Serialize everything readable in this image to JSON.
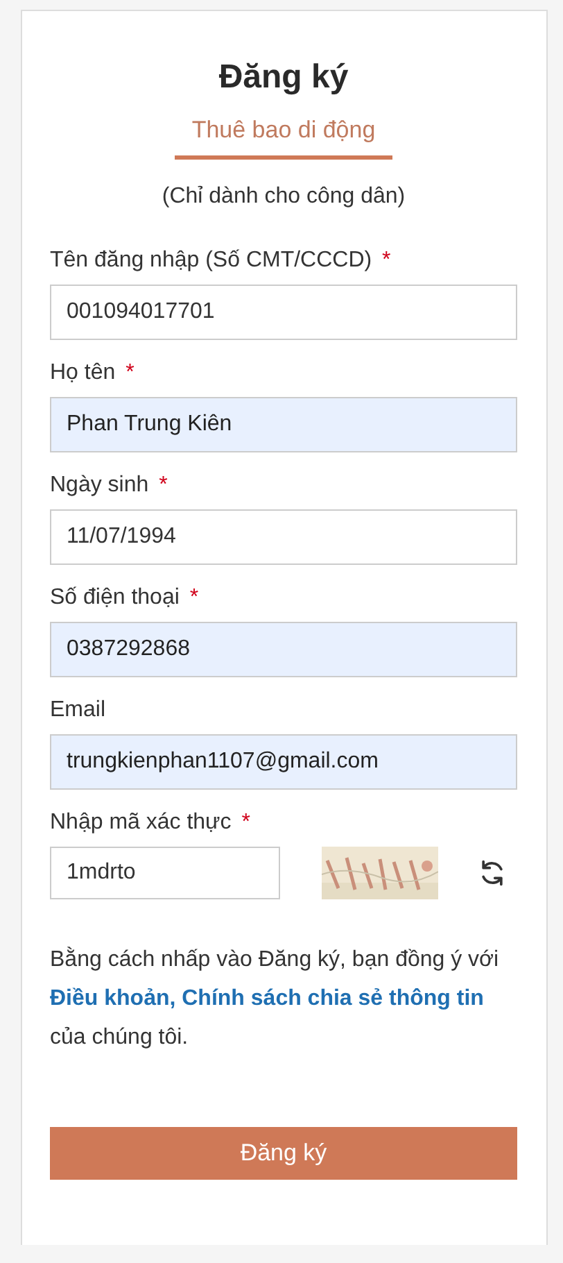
{
  "title": "Đăng ký",
  "tabs": [
    {
      "label": "Thuê bao di động",
      "selected": true
    }
  ],
  "note": "(Chỉ dành cho công dân)",
  "fields": [
    {
      "label": "Tên đăng nhập (Số CMT/CCCD)",
      "required_mark": "*",
      "value": "001094017701",
      "autofilled": false
    },
    {
      "label": "Họ tên",
      "required_mark": "*",
      "value": "Phan Trung Kiên",
      "autofilled": true
    },
    {
      "label": "Ngày sinh",
      "required_mark": "*",
      "value": "11/07/1994",
      "autofilled": false
    },
    {
      "label": "Số điện thoại",
      "required_mark": "*",
      "value": "0387292868",
      "autofilled": true
    },
    {
      "label": "Email",
      "value": "trungkienphan1107@gmail.com",
      "autofilled": true
    }
  ],
  "captcha": {
    "label": "Nhập mã xác thực",
    "required_mark": "*",
    "value": "1mdrto"
  },
  "consent": {
    "before": "Bằng cách nhấp vào Đăng ký, bạn đồng ý với ",
    "link": "Điều khoản, Chính sách chia sẻ thông tin",
    "after": " của chúng tôi."
  },
  "submit": "Đăng ký"
}
